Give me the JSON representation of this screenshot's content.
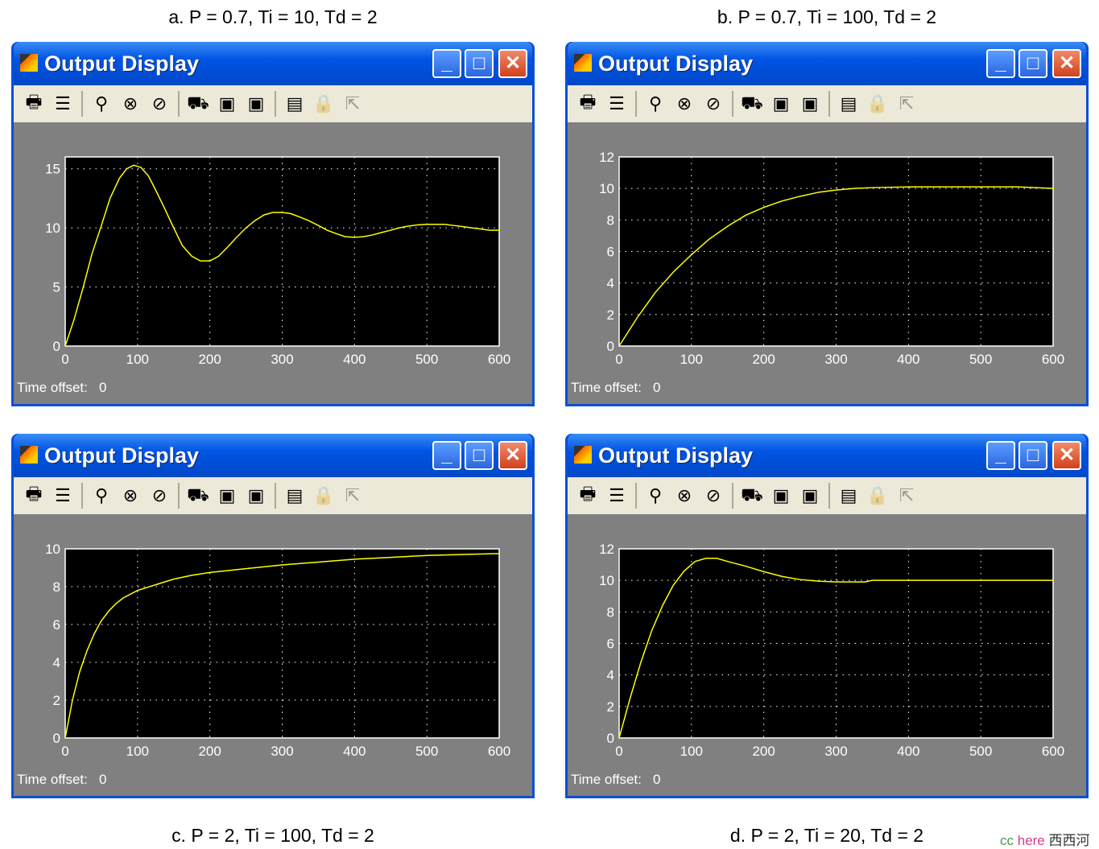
{
  "window_title": "Output Display",
  "time_offset_label": "Time offset:",
  "time_offset_value": "0",
  "watermark": {
    "cc": "cc",
    "here": "here",
    "cn": "西西河"
  },
  "toolbar": [
    "printer-icon",
    "parameters-icon",
    "zoom-icon",
    "zoom-x-icon",
    "zoom-y-icon",
    "autoscale-binoculars-icon",
    "save-axes-icon",
    "restore-axes-icon",
    "floating-scope-icon",
    "lock-icon",
    "signal-selector-icon"
  ],
  "colors": {
    "trace": "#ffff00",
    "plot_bg": "#000000",
    "frame": "#808080",
    "titlebar": "#0054e3"
  },
  "chart_data": [
    {
      "type": "line",
      "caption": "a. P = 0.7, Ti = 10, Td = 2",
      "xlim": [
        0,
        600
      ],
      "ylim": [
        0,
        16
      ],
      "xticks": [
        0,
        100,
        200,
        300,
        400,
        500,
        600
      ],
      "yticks": [
        0,
        5,
        10,
        15
      ],
      "grid": true,
      "x": [
        0,
        12,
        25,
        37,
        50,
        62,
        75,
        85,
        95,
        105,
        115,
        125,
        137,
        150,
        162,
        175,
        187,
        200,
        212,
        225,
        237,
        250,
        262,
        275,
        287,
        300,
        312,
        325,
        337,
        350,
        362,
        375,
        387,
        400,
        412,
        425,
        437,
        450,
        462,
        475,
        487,
        500,
        512,
        525,
        537,
        550,
        562,
        575,
        587,
        600
      ],
      "y": [
        0,
        2.2,
        5,
        7.8,
        10.2,
        12.5,
        14.2,
        15,
        15.3,
        15.1,
        14.4,
        13.2,
        11.7,
        10,
        8.5,
        7.6,
        7.2,
        7.2,
        7.6,
        8.4,
        9.2,
        10,
        10.6,
        11.1,
        11.3,
        11.3,
        11.2,
        10.9,
        10.6,
        10.2,
        9.8,
        9.5,
        9.25,
        9.2,
        9.25,
        9.4,
        9.6,
        9.8,
        10,
        10.15,
        10.25,
        10.3,
        10.3,
        10.3,
        10.2,
        10.1,
        10,
        9.9,
        9.8,
        9.8
      ]
    },
    {
      "type": "line",
      "caption": "b. P = 0.7, Ti = 100, Td = 2",
      "xlim": [
        0,
        600
      ],
      "ylim": [
        0,
        12
      ],
      "xticks": [
        0,
        100,
        200,
        300,
        400,
        500,
        600
      ],
      "yticks": [
        0,
        2,
        4,
        6,
        8,
        10,
        12
      ],
      "grid": true,
      "x": [
        0,
        25,
        50,
        75,
        100,
        125,
        150,
        175,
        200,
        225,
        250,
        275,
        300,
        325,
        350,
        400,
        450,
        500,
        550,
        600
      ],
      "y": [
        0,
        1.8,
        3.4,
        4.7,
        5.8,
        6.8,
        7.6,
        8.3,
        8.8,
        9.2,
        9.5,
        9.75,
        9.9,
        10,
        10.05,
        10.1,
        10.1,
        10.1,
        10.1,
        10
      ]
    },
    {
      "type": "line",
      "caption": "c. P = 2, Ti = 100, Td = 2",
      "xlim": [
        0,
        600
      ],
      "ylim": [
        0,
        10
      ],
      "xticks": [
        0,
        100,
        200,
        300,
        400,
        500,
        600
      ],
      "yticks": [
        0,
        2,
        4,
        6,
        8,
        10
      ],
      "grid": true,
      "x": [
        0,
        10,
        20,
        30,
        40,
        50,
        60,
        70,
        80,
        90,
        100,
        125,
        150,
        175,
        200,
        250,
        300,
        350,
        400,
        450,
        500,
        550,
        600
      ],
      "y": [
        0,
        2,
        3.5,
        4.6,
        5.5,
        6.2,
        6.7,
        7.1,
        7.4,
        7.6,
        7.8,
        8.1,
        8.4,
        8.6,
        8.75,
        8.95,
        9.15,
        9.3,
        9.45,
        9.55,
        9.65,
        9.7,
        9.75
      ]
    },
    {
      "type": "line",
      "caption": "d. P = 2, Ti = 20, Td = 2",
      "xlim": [
        0,
        600
      ],
      "ylim": [
        0,
        12
      ],
      "xticks": [
        0,
        100,
        200,
        300,
        400,
        500,
        600
      ],
      "yticks": [
        0,
        2,
        4,
        6,
        8,
        10,
        12
      ],
      "grid": true,
      "x": [
        0,
        15,
        30,
        45,
        60,
        75,
        90,
        105,
        120,
        135,
        150,
        175,
        200,
        225,
        250,
        275,
        300,
        340,
        350,
        400,
        500,
        600
      ],
      "y": [
        0,
        2.5,
        4.8,
        6.8,
        8.4,
        9.7,
        10.6,
        11.2,
        11.4,
        11.4,
        11.2,
        10.9,
        10.55,
        10.25,
        10.05,
        9.95,
        9.9,
        9.9,
        10,
        10,
        10,
        10
      ]
    }
  ]
}
